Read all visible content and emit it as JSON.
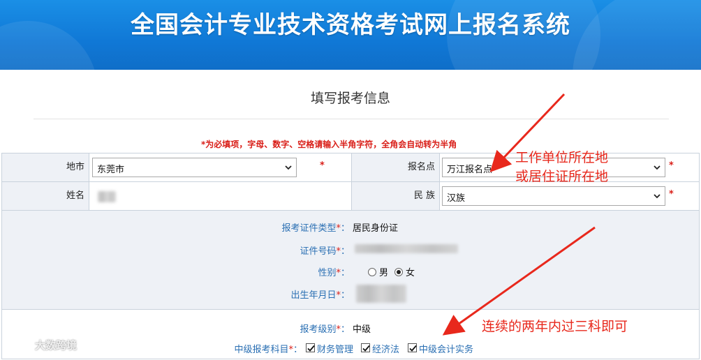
{
  "banner": {
    "title": "全国会计专业技术资格考试网上报名系统"
  },
  "page": {
    "title": "填写报考信息",
    "required_note": "*为必填项，字母、数字、空格请输入半角字符，全角会自动转为半角"
  },
  "form": {
    "city": {
      "label": "地市",
      "value": "东莞市"
    },
    "registration_point": {
      "label": "报名点",
      "value": "万江报名点"
    },
    "name": {
      "label": "姓名"
    },
    "ethnicity": {
      "label": "民 族",
      "value": "汉族"
    },
    "required_mark": "*"
  },
  "info": {
    "id_type": {
      "label": "报考证件类型",
      "value": "居民身份证"
    },
    "id_number": {
      "label": "证件号码"
    },
    "gender": {
      "label": "性别",
      "options": [
        "男",
        "女"
      ],
      "selected": "女"
    },
    "birthdate": {
      "label": "出生年月日"
    },
    "level": {
      "label": "报考级别",
      "value": "中级"
    },
    "subjects": {
      "label": "中级报考科目",
      "items": [
        {
          "label": "财务管理",
          "checked": true
        },
        {
          "label": "经济法",
          "checked": true
        },
        {
          "label": "中级会计实务",
          "checked": true
        }
      ]
    },
    "star": "*",
    "colon": "："
  },
  "annotations": {
    "workplace_line1": "工作单位所在地",
    "workplace_line2": "或居住证所在地",
    "subjects_note": "连续的两年内过三科即可",
    "color": "#e8281c"
  },
  "watermark": {
    "text": "大数跨境"
  },
  "colors": {
    "banner": "#1078d6",
    "label_blue": "#2a6fb3",
    "required_red": "#d91e18"
  }
}
